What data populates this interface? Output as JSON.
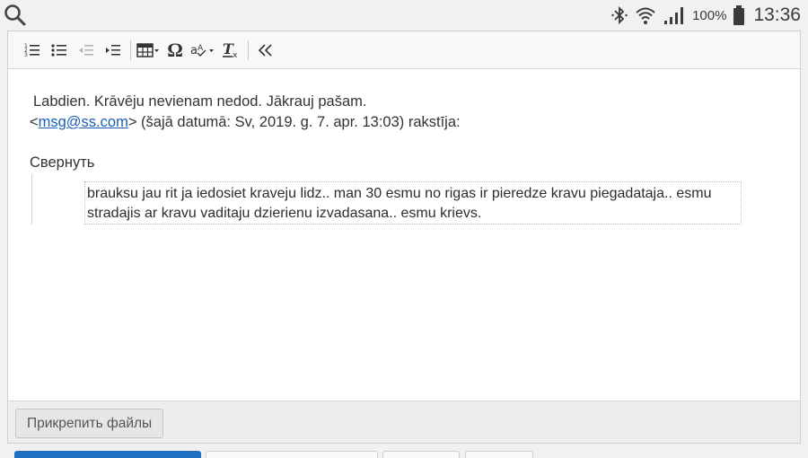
{
  "status_bar": {
    "battery_percent": "100%",
    "time": "13:36"
  },
  "toolbar": {
    "buttons": [
      {
        "name": "numbered-list",
        "enabled": true
      },
      {
        "name": "bulleted-list",
        "enabled": true
      },
      {
        "name": "decrease-indent",
        "enabled": false
      },
      {
        "name": "increase-indent",
        "enabled": true
      },
      {
        "name": "table",
        "enabled": true
      },
      {
        "name": "special-character",
        "enabled": true
      },
      {
        "name": "spell-check",
        "enabled": true
      },
      {
        "name": "remove-format",
        "enabled": true
      },
      {
        "name": "collapse-toolbar",
        "enabled": true
      }
    ]
  },
  "message": {
    "reply_text": "Labdien. Krāvēju nevienam nedod. Jākrauj pašam.",
    "quote_header_prefix": "<",
    "quote_email": "msg@ss.com",
    "quote_header_suffix": "> (šajā datumā: Sv, 2019. g. 7. apr. 13:03) rakstīja:",
    "collapse_label": "Свернуть",
    "quoted_text": "brauksu jau rit ja iedosiet kraveju lidz.. man 30 esmu no rigas ir pieredze kravu piegadataja.. esmu stradajis ar kravu vaditaju dzierienu izvadasana.. esmu krievs."
  },
  "attach": {
    "button_label": "Прикрепить файлы"
  },
  "colors": {
    "link": "#1a5fb4",
    "active_tab": "#1f6fc5"
  }
}
